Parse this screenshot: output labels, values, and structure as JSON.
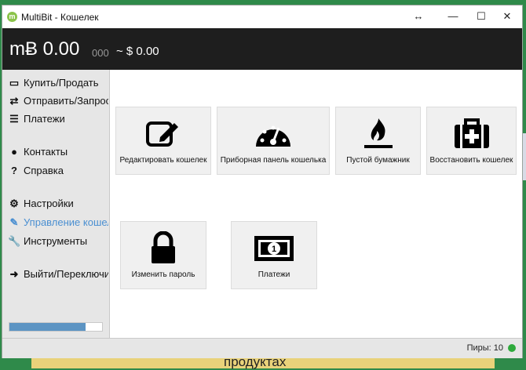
{
  "window": {
    "title": "MultiBit - Кошелек",
    "resize_glyph": "↔",
    "minimize_glyph": "—",
    "maximize_glyph": "☐",
    "close_glyph": "✕"
  },
  "header": {
    "balance_main": "mɃ 0.00",
    "balance_small": "000",
    "balance_fiat": "~ $ 0.00"
  },
  "sidebar": {
    "items": [
      {
        "label": "Купить/Продать",
        "icon": "credit-card-icon",
        "glyph": "▭"
      },
      {
        "label": "Отправить/Запрос",
        "icon": "exchange-icon",
        "glyph": "⇄"
      },
      {
        "label": "Платежи",
        "icon": "list-icon",
        "glyph": "☰"
      },
      {
        "label": "Контакты",
        "icon": "user-icon",
        "glyph": "●"
      },
      {
        "label": "Справка",
        "icon": "question-icon",
        "glyph": "?"
      },
      {
        "label": "Настройки",
        "icon": "gears-icon",
        "glyph": "⚙"
      },
      {
        "label": "Управление кошел",
        "icon": "edit-icon",
        "glyph": "✎"
      },
      {
        "label": "Инструменты",
        "icon": "wrench-icon",
        "glyph": "🔧"
      },
      {
        "label": "Выйти/Переключи",
        "icon": "sign-out-icon",
        "glyph": "➜"
      }
    ],
    "sync_progress": 0.82
  },
  "cards": [
    {
      "label": "Редактировать кошелек",
      "icon": "edit-icon"
    },
    {
      "label": "Приборная панель кошелька",
      "icon": "dashboard-icon"
    },
    {
      "label": "Пустой бумажник",
      "icon": "fire-icon"
    },
    {
      "label": "Восстановить кошелек",
      "icon": "medkit-icon"
    },
    {
      "label": "Изменить пароль",
      "icon": "lock-icon"
    },
    {
      "label": "Платежи",
      "icon": "money-icon"
    }
  ],
  "status": {
    "peers": "Пиры: 10",
    "peer_color": "#2eaa3c"
  },
  "background": {
    "text": "продуктах"
  }
}
